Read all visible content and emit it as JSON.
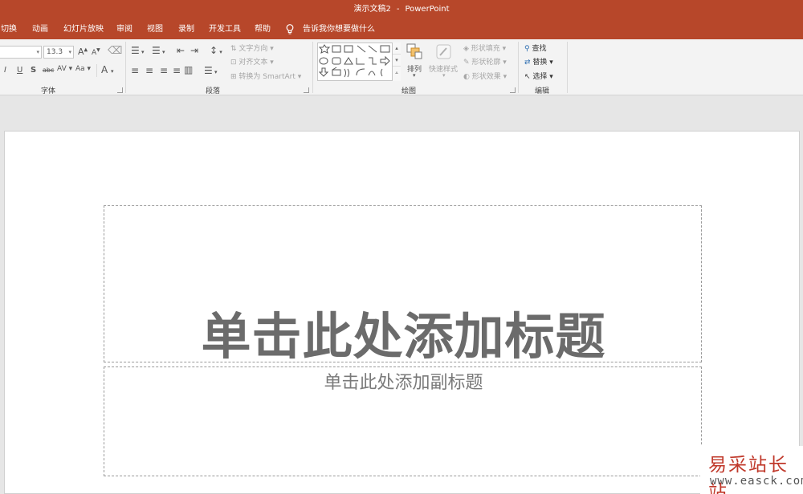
{
  "window": {
    "document": "演示文稿2",
    "separator": "-",
    "app": "PowerPoint"
  },
  "tabs": [
    "切换",
    "动画",
    "幻灯片放映",
    "审阅",
    "视图",
    "录制",
    "开发工具",
    "帮助"
  ],
  "tell_me": "告诉我你想要做什么",
  "ribbon": {
    "font": {
      "size": "13.3",
      "grow": "A",
      "shrink": "A",
      "italic": "I",
      "underline": "U",
      "shadow": "S",
      "strike": "abc",
      "spacing": "AV",
      "case": "Aa",
      "color": "A",
      "label": "字体"
    },
    "paragraph": {
      "text_direction": "文字方向",
      "align_text": "对齐文本",
      "convert_smartart": "转换为 SmartArt",
      "label": "段落"
    },
    "drawing": {
      "arrange": "排列",
      "quick_styles": "快速样式",
      "shape_fill": "形状填充",
      "shape_outline": "形状轮廓",
      "shape_effects": "形状效果",
      "label": "绘图"
    },
    "editing": {
      "find": "查找",
      "replace": "替换",
      "select": "选择",
      "label": "编辑"
    }
  },
  "slide": {
    "title_placeholder": "单击此处添加标题",
    "subtitle_placeholder": "单击此处添加副标题"
  },
  "watermark": {
    "name": "易采站长站",
    "url": "www.easck.com"
  },
  "colors": {
    "accent": "#b7472a",
    "ribbon_bg": "#f3f3f3",
    "workspace_bg": "#e6e6e6"
  }
}
